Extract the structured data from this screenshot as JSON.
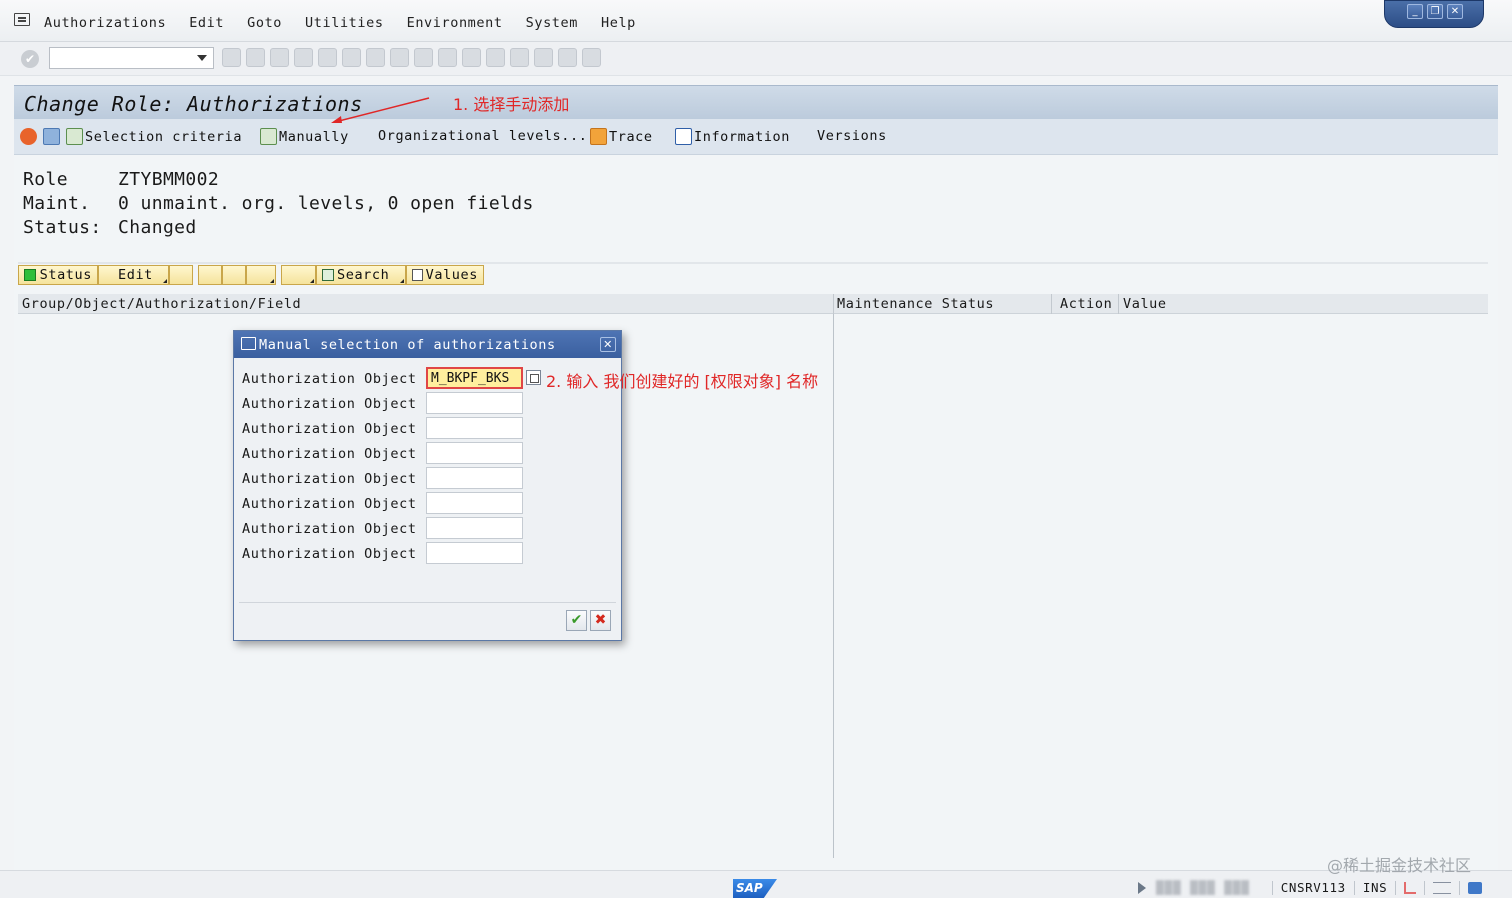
{
  "menu": {
    "items": [
      "Authorizations",
      "Edit",
      "Goto",
      "Utilities",
      "Environment",
      "System",
      "Help"
    ]
  },
  "window_controls": {
    "minimize": "_",
    "restore": "❐",
    "close": "✕"
  },
  "screen": {
    "title": "Change Role: Authorizations"
  },
  "app_toolbar": {
    "selection_criteria": "Selection criteria",
    "manually": "Manually",
    "org_levels": "Organizational levels...",
    "trace": "Trace",
    "information": "Information",
    "versions": "Versions"
  },
  "role_info": {
    "role_label": "Role",
    "role_value": "ZTYBMM002",
    "maint_label": "Maint.",
    "maint_value": "0 unmaint. org. levels, 0 open fields",
    "status_label": "Status:",
    "status_value": "Changed"
  },
  "tree_toolbar": {
    "status": "Status",
    "edit": "Edit",
    "search": "Search",
    "values": "Values"
  },
  "tree_header": {
    "col_path": "Group/Object/Authorization/Field",
    "col_maint": "Maintenance Status",
    "col_action": "Action",
    "col_value": "Value"
  },
  "dialog": {
    "title": "Manual selection of authorizations",
    "rows": [
      {
        "label": "Authorization Object",
        "value": "M_BKPF_BKS"
      },
      {
        "label": "Authorization Object",
        "value": ""
      },
      {
        "label": "Authorization Object",
        "value": ""
      },
      {
        "label": "Authorization Object",
        "value": ""
      },
      {
        "label": "Authorization Object",
        "value": ""
      },
      {
        "label": "Authorization Object",
        "value": ""
      },
      {
        "label": "Authorization Object",
        "value": ""
      },
      {
        "label": "Authorization Object",
        "value": ""
      }
    ],
    "ok": "✔",
    "cancel": "✖"
  },
  "annotations": {
    "step1": "1. 选择手动添加",
    "step2": "2. 输入 我们创建好的 [权限对象] 名称",
    "color": "#e02727"
  },
  "status_bar": {
    "logo": "SAP",
    "server": "CNSRV113",
    "mode": "INS",
    "credit": "@稀土掘金技术社区"
  }
}
